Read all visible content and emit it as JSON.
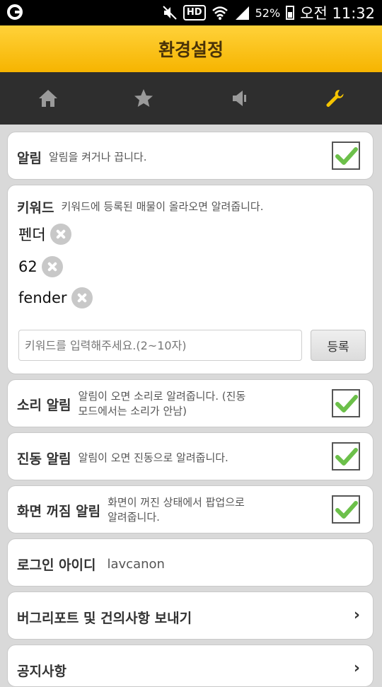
{
  "status_bar": {
    "hd_label": "HD",
    "battery_percent": "52%",
    "time": "오전 11:32"
  },
  "header": {
    "title": "환경설정"
  },
  "tabs": [
    {
      "icon": "home-icon"
    },
    {
      "icon": "star-icon"
    },
    {
      "icon": "speaker-icon"
    },
    {
      "icon": "wrench-icon",
      "active": true
    }
  ],
  "colors": {
    "accent": "#f6b400",
    "tab_active": "#f5c400",
    "check_green": "#6cc04a"
  },
  "settings": {
    "alarm": {
      "label": "알림",
      "desc": "알림을 켜거나 끕니다.",
      "checked": true
    },
    "keyword": {
      "label": "키워드",
      "desc": "키워드에 등록된 매물이 올라오면 알려줍니다.",
      "items": [
        "펜더",
        "62",
        "fender"
      ],
      "input_placeholder": "키워드를 입력해주세요.(2~10자)",
      "register_label": "등록"
    },
    "sound": {
      "label": "소리 알림",
      "desc_line1": "알림이 오면 소리로 알려줍니다. (진동",
      "desc_line2": "모드에서는 소리가 안남)",
      "checked": true
    },
    "vibrate": {
      "label": "진동 알림",
      "desc": "알림이 오면 진동으로 알려줍니다.",
      "checked": true
    },
    "screen_off": {
      "label": "화면 꺼짐 알림",
      "desc_line1": "화면이 꺼진 상태에서 팝업으로",
      "desc_line2": "알려줍니다.",
      "checked": true
    },
    "login": {
      "label": "로그인 아이디",
      "value": "lavcanon"
    },
    "bug_report": {
      "label": "버그리포트 및 건의사항 보내기"
    },
    "notice": {
      "label": "공지사항"
    }
  }
}
